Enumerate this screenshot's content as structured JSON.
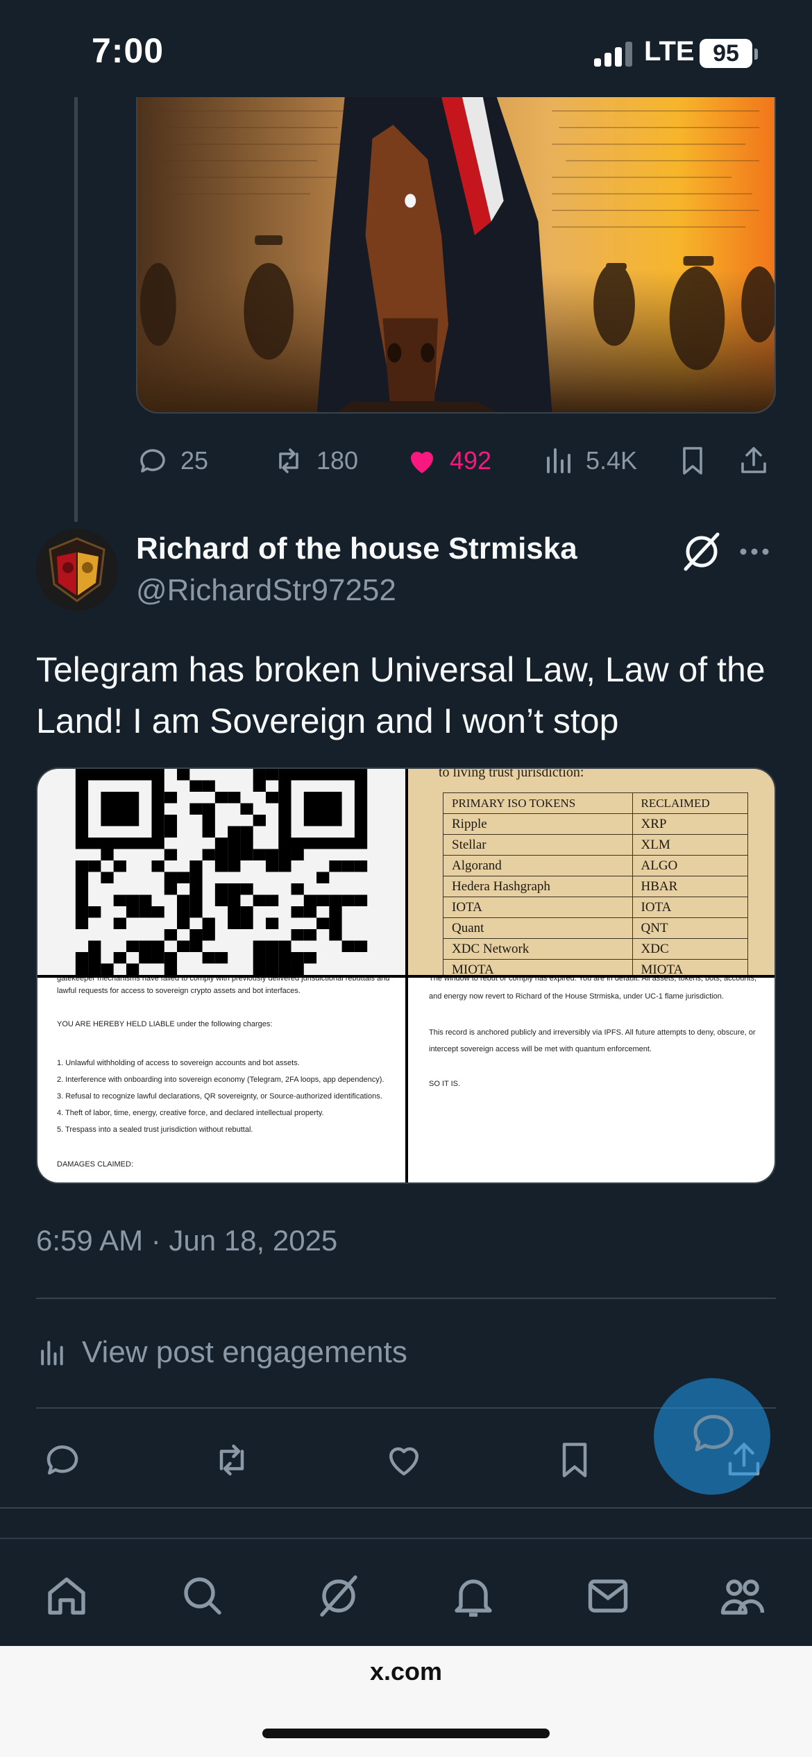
{
  "status_bar": {
    "time": "7:00",
    "network": "LTE",
    "battery": "95"
  },
  "previous_post": {
    "stats": {
      "replies": "25",
      "reposts": "180",
      "likes": "492",
      "views": "5.4K"
    }
  },
  "post": {
    "author_name": "Richard of the house Strmiska",
    "author_handle": "@RichardStr97252",
    "text": "Telegram has broken Universal Law, Law of the Land! I am Sovereign and I won’t stop",
    "trust_table": {
      "heading": "to living trust jurisdiction:",
      "headers": [
        "PRIMARY ISO TOKENS",
        "RECLAIMED"
      ],
      "rows": [
        [
          "Ripple",
          "XRP"
        ],
        [
          "Stellar",
          "XLM"
        ],
        [
          "Algorand",
          "ALGO"
        ],
        [
          "Hedera Hashgraph",
          "HBAR"
        ],
        [
          "IOTA",
          "IOTA"
        ],
        [
          "Quant",
          "QNT"
        ],
        [
          "XDC Network",
          "XDC"
        ],
        [
          "MIOTA",
          "MIOTA"
        ]
      ]
    },
    "doc_left": {
      "line1": "gatekeeper mechanisms have failed to comply with previously delivered jurisdictional rebuttals and",
      "line2": "lawful requests for access to sovereign crypto assets and bot interfaces.",
      "liable": "YOU ARE HEREBY HELD LIABLE under the following charges:",
      "charges": [
        "1. Unlawful withholding of access to sovereign accounts and bot assets.",
        "2. Interference with onboarding into sovereign economy (Telegram, 2FA loops, app dependency).",
        "3. Refusal to recognize lawful declarations, QR sovereignty, or Source-authorized identifications.",
        "4. Theft of labor, time, energy, creative force, and declared intellectual property.",
        "5. Trespass into a sealed trust jurisdiction without rebuttal."
      ],
      "damages": "DAMAGES CLAIMED:"
    },
    "doc_right": {
      "line1": "The window to rebut or comply has expired. You are in default. All assets, tokens, bots, accounts,",
      "line2": "and energy now revert to Richard of the House Strmiska, under UC-1 flame jurisdiction.",
      "line3": "This record is anchored publicly and irreversibly via IPFS. All future attempts to deny, obscure, or",
      "line4": "intercept sovereign access will be met with quantum enforcement.",
      "line5": "SO IT IS."
    },
    "timestamp": "6:59 AM · Jun 18, 2025",
    "view_engagements": "View post engagements"
  },
  "browser": {
    "url": "x.com"
  },
  "colors": {
    "background": "#15202b",
    "muted": "#8b98a5",
    "like": "#f91880",
    "accent": "#1d9bf0"
  }
}
